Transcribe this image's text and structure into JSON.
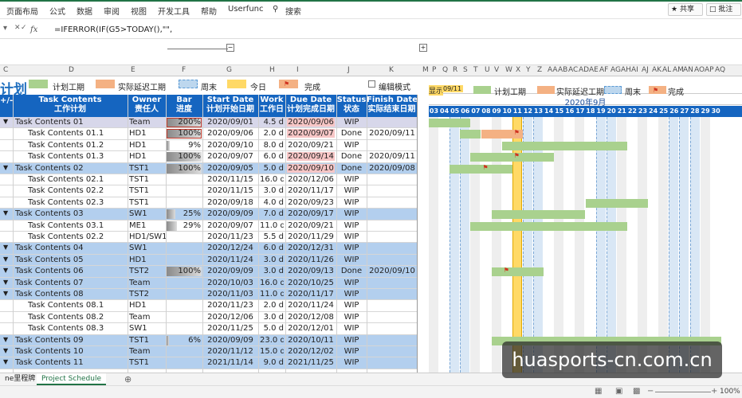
{
  "menu": {
    "items": [
      "页面布局",
      "公式",
      "数据",
      "审阅",
      "视图",
      "开发工具",
      "帮助",
      "Userfunc",
      "搜索"
    ],
    "share": "共享",
    "comment": "批注"
  },
  "formula": {
    "fx": "fx",
    "text": "=IFERROR(IF(G5>TODAY(),\"\","
  },
  "colhdr": [
    "C",
    "D",
    "E",
    "F",
    "G",
    "H",
    "I",
    "J",
    "K",
    "M",
    "P",
    "Q",
    "R",
    "S",
    "T",
    "U",
    "V",
    "W",
    "X",
    "Y",
    "Z",
    "AA",
    "AB",
    "AC",
    "AD",
    "AE",
    "AF",
    "AG",
    "AH",
    "AI",
    "AJ",
    "AK",
    "AL",
    "AM",
    "AN",
    "AO",
    "AP",
    "AQ"
  ],
  "legend": {
    "title": "计划",
    "planned": "计划工期",
    "delay": "实际延迟工期",
    "weekend": "周末",
    "today": "今日",
    "done": "完成",
    "edit": "编辑模式"
  },
  "headers": {
    "toggle": "+/-",
    "task": [
      "Task Contents",
      "工作计划"
    ],
    "owner": [
      "Owner",
      "责任人"
    ],
    "bar": [
      "Bar",
      "进度"
    ],
    "start": [
      "Start Date",
      "计划开始日期"
    ],
    "work": [
      "Work",
      "工作日"
    ],
    "due": [
      "Due Date",
      "计划完成日期"
    ],
    "status": [
      "Status",
      "状态"
    ],
    "finish": [
      "Finish Date",
      "实际结束日期"
    ]
  },
  "rows": [
    {
      "task": "Task Contents 01",
      "owner": "Team",
      "pct": "200%",
      "start": "2020/09/01",
      "work": "4.5 d",
      "due": "2020/09/06",
      "status": "WIP",
      "finish": "",
      "level": 0
    },
    {
      "task": "Task Contents 01.1",
      "owner": "HD1",
      "pct": "100%",
      "start": "2020/09/06",
      "work": "2.0 d",
      "due": "2020/09/07",
      "status": "Done",
      "finish": "2020/09/11",
      "level": 1
    },
    {
      "task": "Task Contents 01.2",
      "owner": "HD1",
      "pct": "9%",
      "start": "2020/09/10",
      "work": "8.0 d",
      "due": "2020/09/21",
      "status": "WIP",
      "finish": "",
      "level": 1
    },
    {
      "task": "Task Contents 01.3",
      "owner": "HD1",
      "pct": "100%",
      "start": "2020/09/07",
      "work": "6.0 d",
      "due": "2020/09/14",
      "status": "Done",
      "finish": "2020/09/11",
      "level": 1
    },
    {
      "task": "Task Contents 02",
      "owner": "TST1",
      "pct": "100%",
      "start": "2020/09/05",
      "work": "5.0 d",
      "due": "2020/09/10",
      "status": "Done",
      "finish": "2020/09/08",
      "level": 0
    },
    {
      "task": "Task Contents 02.1",
      "owner": "TST1",
      "pct": "",
      "start": "2020/11/15",
      "work": "16.0 d",
      "due": "2020/12/06",
      "status": "WIP",
      "finish": "",
      "level": 1
    },
    {
      "task": "Task Contents 02.2",
      "owner": "TST1",
      "pct": "",
      "start": "2020/11/15",
      "work": "3.0 d",
      "due": "2020/11/17",
      "status": "WIP",
      "finish": "",
      "level": 1
    },
    {
      "task": "Task Contents 02.3",
      "owner": "TST1",
      "pct": "",
      "start": "2020/09/18",
      "work": "4.0 d",
      "due": "2020/09/23",
      "status": "WIP",
      "finish": "",
      "level": 1
    },
    {
      "task": "Task Contents 03",
      "owner": "SW1",
      "pct": "25%",
      "start": "2020/09/09",
      "work": "7.0 d",
      "due": "2020/09/17",
      "status": "WIP",
      "finish": "",
      "level": 0
    },
    {
      "task": "Task Contents 03.1",
      "owner": "ME1",
      "pct": "29%",
      "start": "2020/09/07",
      "work": "11.0 d",
      "due": "2020/09/21",
      "status": "WIP",
      "finish": "",
      "level": 1
    },
    {
      "task": "Task Contents 02.2",
      "owner": "HD1/SW1",
      "pct": "",
      "start": "2020/11/23",
      "work": "5.5 d",
      "due": "2020/11/29",
      "status": "WIP",
      "finish": "",
      "level": 1
    },
    {
      "task": "Task Contents 04",
      "owner": "SW1",
      "pct": "",
      "start": "2020/12/24",
      "work": "6.0 d",
      "due": "2020/12/31",
      "status": "WIP",
      "finish": "",
      "level": 0
    },
    {
      "task": "Task Contents 05",
      "owner": "HD1",
      "pct": "",
      "start": "2020/11/24",
      "work": "3.0 d",
      "due": "2020/11/26",
      "status": "WIP",
      "finish": "",
      "level": 0
    },
    {
      "task": "Task Contents 06",
      "owner": "TST2",
      "pct": "100%",
      "start": "2020/09/09",
      "work": "3.0 d",
      "due": "2020/09/13",
      "status": "Done",
      "finish": "2020/09/10",
      "level": 0
    },
    {
      "task": "Task Contents 07",
      "owner": "Team",
      "pct": "",
      "start": "2020/10/03",
      "work": "16.0 d",
      "due": "2020/10/25",
      "status": "WIP",
      "finish": "",
      "level": 0
    },
    {
      "task": "Task Contents 08",
      "owner": "TST2",
      "pct": "",
      "start": "2020/11/03",
      "work": "11.0 d",
      "due": "2020/11/17",
      "status": "WIP",
      "finish": "",
      "level": 0
    },
    {
      "task": "Task Contents 08.1",
      "owner": "HD1",
      "pct": "",
      "start": "2020/11/23",
      "work": "2.0 d",
      "due": "2020/11/24",
      "status": "WIP",
      "finish": "",
      "level": 1
    },
    {
      "task": "Task Contents 08.2",
      "owner": "Team",
      "pct": "",
      "start": "2020/12/06",
      "work": "3.0 d",
      "due": "2020/12/08",
      "status": "WIP",
      "finish": "",
      "level": 1
    },
    {
      "task": "Task Contents 08.3",
      "owner": "SW1",
      "pct": "",
      "start": "2020/11/25",
      "work": "5.0 d",
      "due": "2020/12/01",
      "status": "WIP",
      "finish": "",
      "level": 1
    },
    {
      "task": "Task Contents 09",
      "owner": "TST1",
      "pct": "6%",
      "start": "2020/09/09",
      "work": "23.0 d",
      "due": "2020/10/11",
      "status": "WIP",
      "finish": "",
      "level": 0
    },
    {
      "task": "Task Contents 10",
      "owner": "Team",
      "pct": "",
      "start": "2020/11/12",
      "work": "15.0 d",
      "due": "2020/12/02",
      "status": "WIP",
      "finish": "",
      "level": 0
    },
    {
      "task": "Task Contents 11",
      "owner": "TST1",
      "pct": "",
      "start": "2021/11/14",
      "work": "9.0 d",
      "due": "2021/11/25",
      "status": "WIP",
      "finish": "",
      "level": 0
    }
  ],
  "gantt": {
    "show_label": "显示",
    "show_value": "09/11",
    "month": "2020年9月",
    "days": [
      "03",
      "04",
      "05",
      "06",
      "07",
      "08",
      "09",
      "10",
      "11",
      "12",
      "13",
      "14",
      "15",
      "16",
      "17",
      "18",
      "19",
      "20",
      "21",
      "22",
      "23",
      "24",
      "25",
      "26",
      "27",
      "28",
      "29",
      "30"
    ]
  },
  "sheets": {
    "tab1": "ne里程牌",
    "tab2": "Project Schedule"
  },
  "status": {
    "zoom": "100%"
  },
  "watermark": "huasports-cn.com.cn",
  "colors": {
    "header": "#1565c0",
    "parent": "#b3cfee",
    "planned": "#a9d18e",
    "delay": "#f4b183",
    "weekend": "#bdd7ee",
    "today": "#ffc000",
    "flag": "#d0331f"
  }
}
